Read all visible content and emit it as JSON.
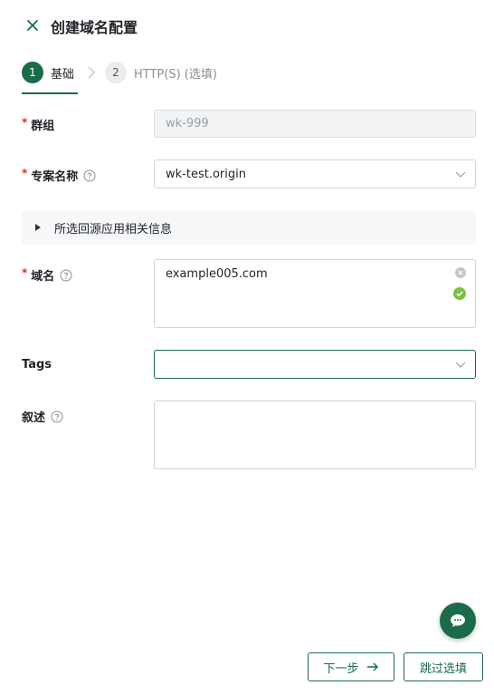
{
  "header": {
    "title": "创建域名配置"
  },
  "steps": [
    {
      "num": "1",
      "label": "基础"
    },
    {
      "num": "2",
      "label": "HTTP(S) (选填)"
    }
  ],
  "form": {
    "group": {
      "label": "群组",
      "value": "wk-999"
    },
    "project": {
      "label": "专案名称",
      "value": "wk-test.origin"
    },
    "collapse": {
      "label": "所选回源应用相关信息"
    },
    "domain": {
      "label": "域名",
      "value": "example005.com"
    },
    "tags": {
      "label": "Tags",
      "value": ""
    },
    "description": {
      "label": "叙述",
      "value": ""
    }
  },
  "footer": {
    "next_label": "下一步",
    "skip_label": "跳过选填"
  },
  "colors": {
    "accent": "#1a6b4a",
    "required": "#d93025",
    "success": "#7cc142"
  }
}
